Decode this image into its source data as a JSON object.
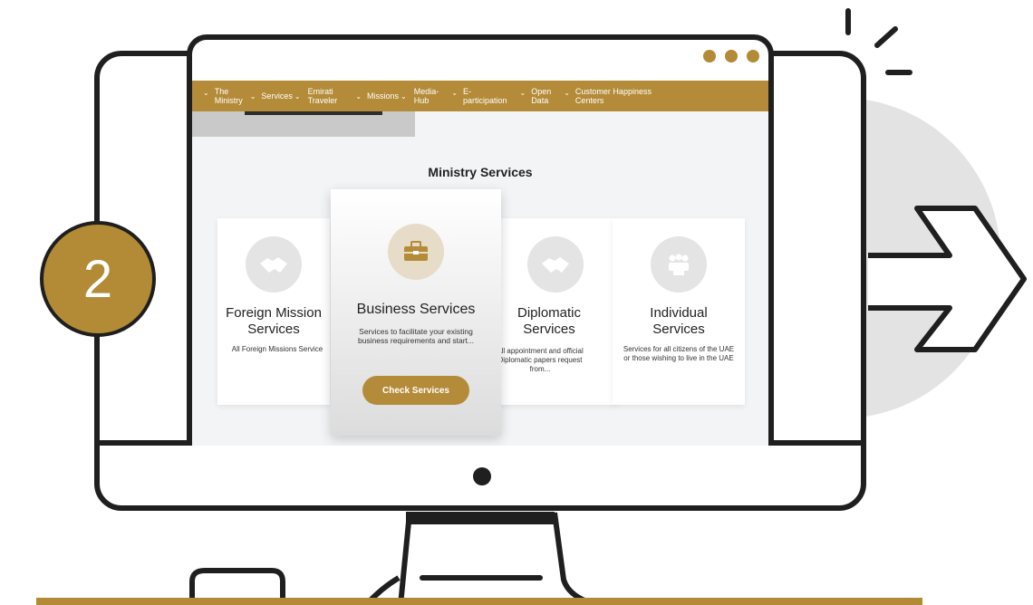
{
  "step_number": "2",
  "colors": {
    "accent": "#b38b36",
    "outline": "#1f1f1f",
    "content_bg": "#f3f4f6"
  },
  "nav": {
    "items": [
      {
        "label": "The\nMinistry"
      },
      {
        "label": "Services"
      },
      {
        "label": "Emirati\nTraveler"
      },
      {
        "label": "Missions"
      },
      {
        "label": "Media-\nHub"
      },
      {
        "label": "E-\nparticipation"
      },
      {
        "label": "Open\nData"
      },
      {
        "label": "Customer Happiness\nCenters"
      }
    ]
  },
  "section": {
    "title": "Ministry Services"
  },
  "cards": [
    {
      "title": "Foreign Mission Services",
      "description": "All Foreign Missions Service",
      "icon": "handshake-icon"
    },
    {
      "title": "Business Services",
      "description": "Services to facilitate your existing business requirements and start...",
      "icon": "briefcase-icon",
      "button": "Check Services"
    },
    {
      "title": "Diplomatic Services",
      "description": "All appointment and official Diplomatic papers request from...",
      "icon": "handshake-icon"
    },
    {
      "title": "Individual Services",
      "description": "Services for all citizens of the UAE or those wishing to live in the UAE",
      "icon": "people-icon"
    }
  ]
}
